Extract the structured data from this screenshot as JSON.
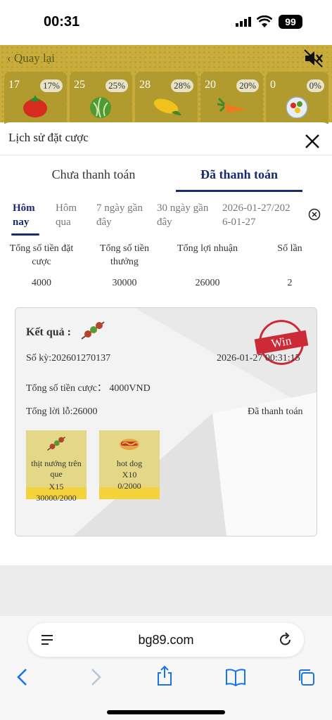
{
  "status": {
    "time": "00:31",
    "battery": "99"
  },
  "game": {
    "back_label": "Quay lại",
    "tiles": [
      {
        "count": "17",
        "percent": "17%",
        "icon": "tomato-icon"
      },
      {
        "count": "25",
        "percent": "25%",
        "icon": "cabbage-icon"
      },
      {
        "count": "28",
        "percent": "28%",
        "icon": "corn-icon"
      },
      {
        "count": "20",
        "percent": "20%",
        "icon": "carrot-icon"
      },
      {
        "count": "0",
        "percent": "0%",
        "icon": "salad-icon"
      }
    ]
  },
  "sheet": {
    "title": "Lịch sử đặt cược",
    "tabs": [
      "Chưa thanh toán",
      "Đã thanh toán"
    ],
    "active_tab": 1,
    "filters": [
      {
        "label": "Hôm nay",
        "active": true
      },
      {
        "label": "Hôm qua",
        "active": false
      },
      {
        "label": "7 ngày gần đây",
        "active": false
      },
      {
        "label": "30 ngày gần đây",
        "active": false
      },
      {
        "label": "2026-01-27/2026-01-27",
        "active": false
      }
    ],
    "summary": {
      "headers": [
        "Tổng số tiền đặt cược",
        "Tổng số tiền thưởng",
        "Tổng lợi nhuận",
        "Số lần"
      ],
      "values": [
        "4000",
        "30000",
        "26000",
        "2"
      ]
    }
  },
  "card": {
    "result_label": "Kết quả :",
    "stamp": "Win",
    "period": "Số kỳ:202601270137",
    "datetime": "2026-01-27 00:31:15",
    "total_bet": "Tổng số tiền cược：  4000VND",
    "profit": "Tổng lời lỗ:26000",
    "paid_status": "Đã thanh toán",
    "items": [
      {
        "name": "thịt nướng trên que",
        "mult": "X15",
        "amount": "30000/2000",
        "icon": "skewer-icon"
      },
      {
        "name": "hot dog",
        "mult": "X10",
        "amount": "0/2000",
        "icon": "hotdog-icon"
      }
    ]
  },
  "browser": {
    "domain": "bg89.com"
  },
  "colors": {
    "accent": "#1a2a6e",
    "stamp_red": "#cc2a36",
    "item_bg": "#e4d788",
    "item_foot": "#f4d23c"
  }
}
